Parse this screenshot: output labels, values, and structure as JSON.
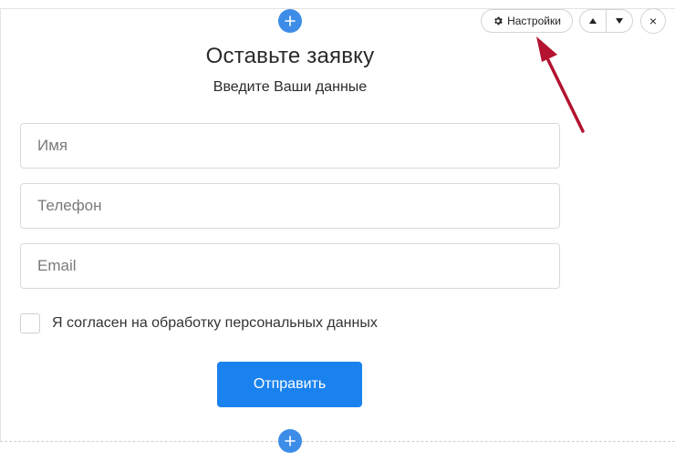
{
  "toolbar": {
    "settings_label": "Настройки",
    "settings_icon": "gear-icon",
    "move_up_icon": "triangle-up-icon",
    "move_down_icon": "triangle-down-icon",
    "close_label": "×"
  },
  "block_controls": {
    "add_top_icon": "plus-icon",
    "add_bottom_icon": "plus-icon"
  },
  "form": {
    "title": "Оставьте заявку",
    "subtitle": "Введите Ваши данные",
    "fields": [
      {
        "placeholder": "Имя",
        "value": ""
      },
      {
        "placeholder": "Телефон",
        "value": ""
      },
      {
        "placeholder": "Email",
        "value": ""
      }
    ],
    "consent_label": "Я согласен на обработку персональных данных",
    "consent_checked": false,
    "submit_label": "Отправить"
  },
  "colors": {
    "accent": "#3d8de8",
    "submit": "#1a82ee",
    "annotation_arrow": "#b3132f"
  }
}
